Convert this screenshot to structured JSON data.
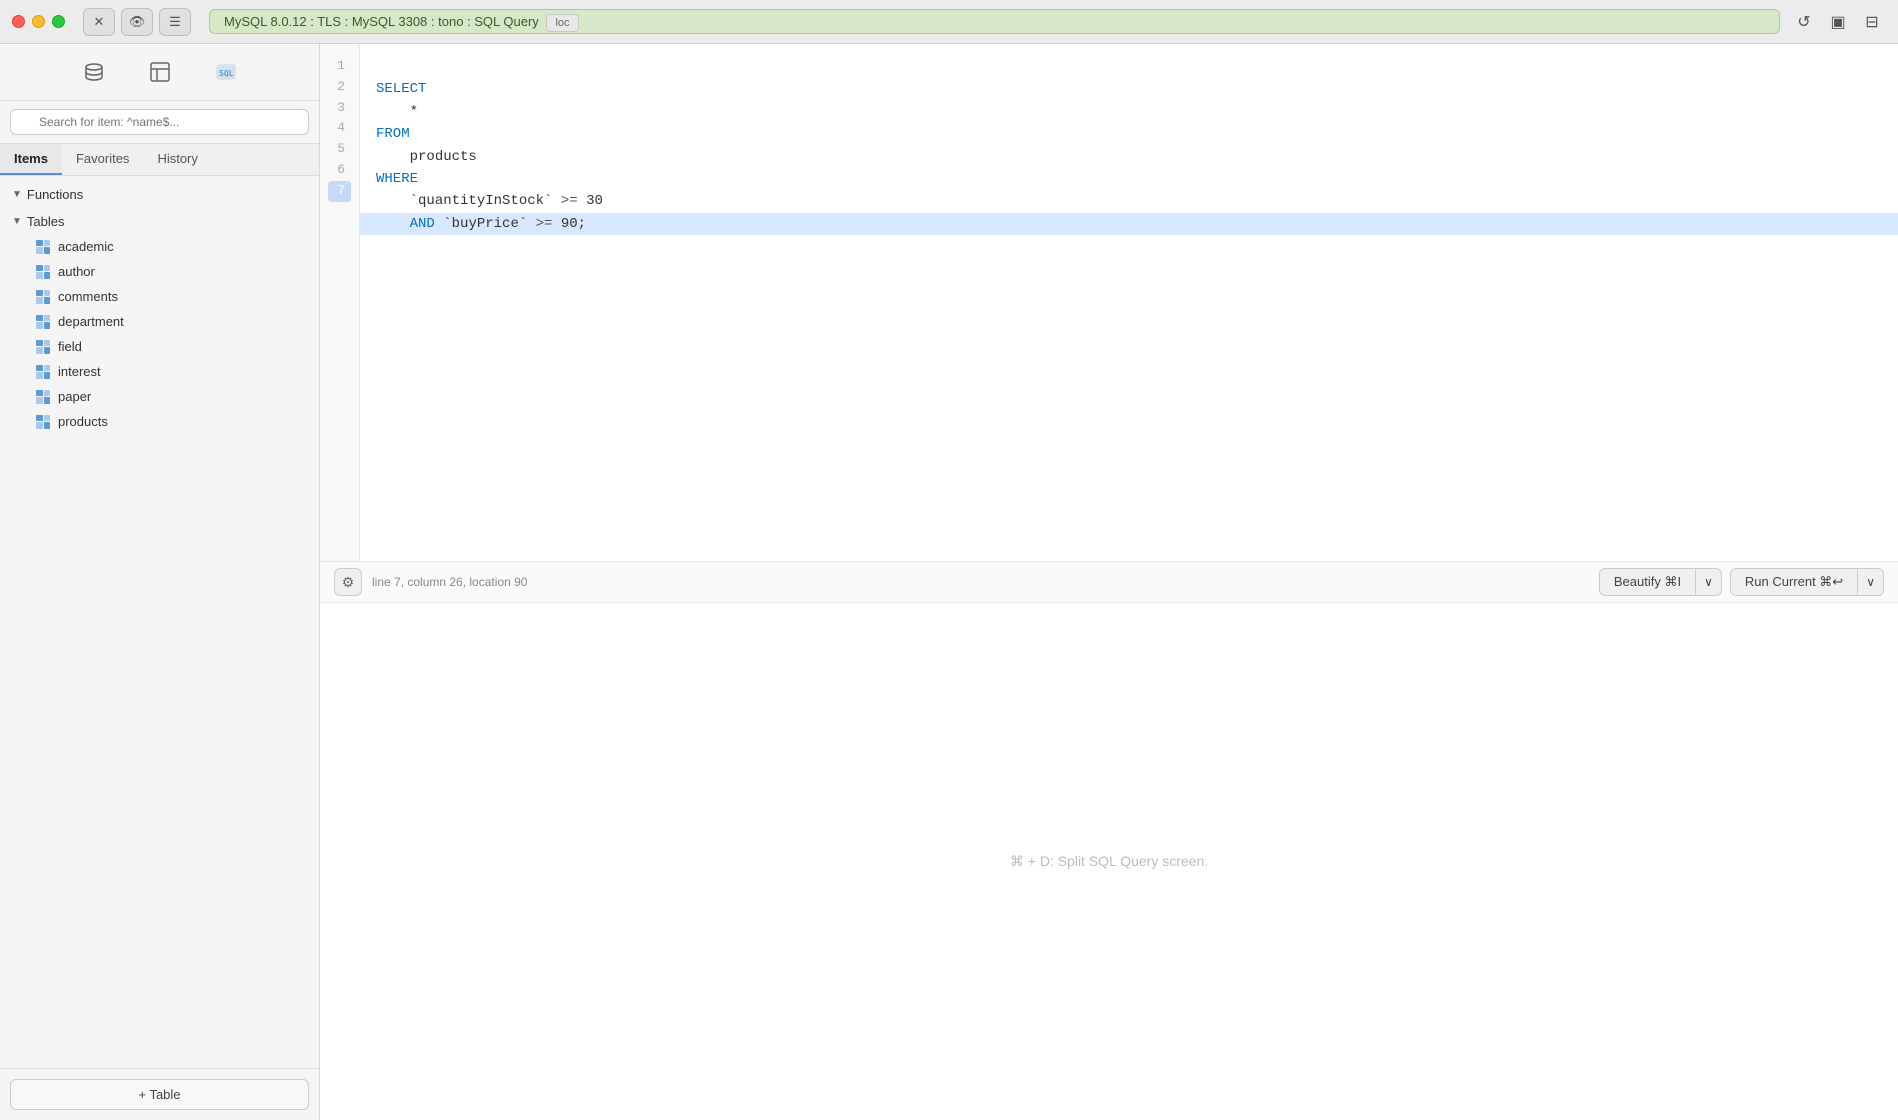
{
  "titlebar": {
    "connection": "MySQL 8.0.12 : TLS : MySQL 3308 : tono : SQL Query",
    "loc_label": "loc"
  },
  "sidebar": {
    "search_placeholder": "Search for item: ^name$...",
    "tabs": [
      {
        "id": "items",
        "label": "Items",
        "active": true
      },
      {
        "id": "favorites",
        "label": "Favorites",
        "active": false
      },
      {
        "id": "history",
        "label": "History",
        "active": false
      }
    ],
    "functions_label": "Functions",
    "tables_label": "Tables",
    "tables": [
      {
        "name": "academic"
      },
      {
        "name": "author"
      },
      {
        "name": "comments"
      },
      {
        "name": "department"
      },
      {
        "name": "field"
      },
      {
        "name": "interest"
      },
      {
        "name": "paper"
      },
      {
        "name": "products"
      }
    ],
    "add_table_label": "+ Table"
  },
  "editor": {
    "lines": [
      {
        "num": 1,
        "content": "SELECT",
        "highlighted": false
      },
      {
        "num": 2,
        "content": "    *",
        "highlighted": false
      },
      {
        "num": 3,
        "content": "FROM",
        "highlighted": false
      },
      {
        "num": 4,
        "content": "    products",
        "highlighted": false
      },
      {
        "num": 5,
        "content": "WHERE",
        "highlighted": false
      },
      {
        "num": 6,
        "content": "    `quantityInStock` >= 30",
        "highlighted": false
      },
      {
        "num": 7,
        "content": "    AND `buyPrice` >= 90;",
        "highlighted": true
      }
    ],
    "status": "line 7, column 26, location 90",
    "beautify_label": "Beautify ⌘I",
    "run_label": "Run Current ⌘↩",
    "split_hint": "⌘ + D: Split SQL Query screen."
  }
}
